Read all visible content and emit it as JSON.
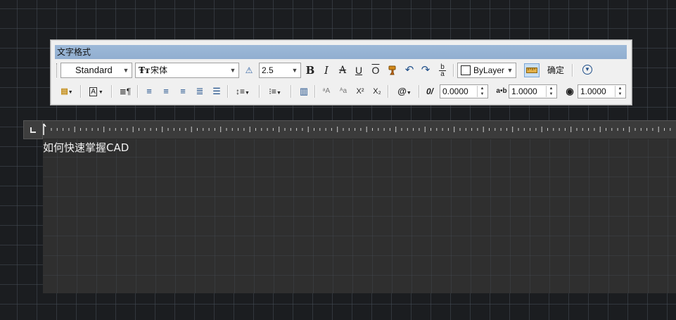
{
  "toolbar": {
    "title": "文字格式",
    "style": "Standard",
    "font": "宋体",
    "font_icon": "truetype-font-icon",
    "annotative_icon": "annotative-icon",
    "text_height": "2.5",
    "bold": "B",
    "italic": "I",
    "strike": "A",
    "underline": "U",
    "overline": "O",
    "undo": "↶",
    "redo": "↷",
    "stack_top": "b",
    "stack_bottom": "a",
    "color": "ByLayer",
    "ok": "确定",
    "oblique_angle": "0.0000",
    "tracking": "1.0000",
    "width_factor": "1.0000",
    "superscript": "X²",
    "subscript": "X₂",
    "symbol": "@",
    "oblique_icon": "0/",
    "tracking_icon": "a•b"
  },
  "editor": {
    "text": "如何快速掌握CAD"
  },
  "colors": {
    "canvas": "#1b1d20",
    "titlebar": "#9db9d8",
    "editor_bg": "#2f2f2f"
  }
}
